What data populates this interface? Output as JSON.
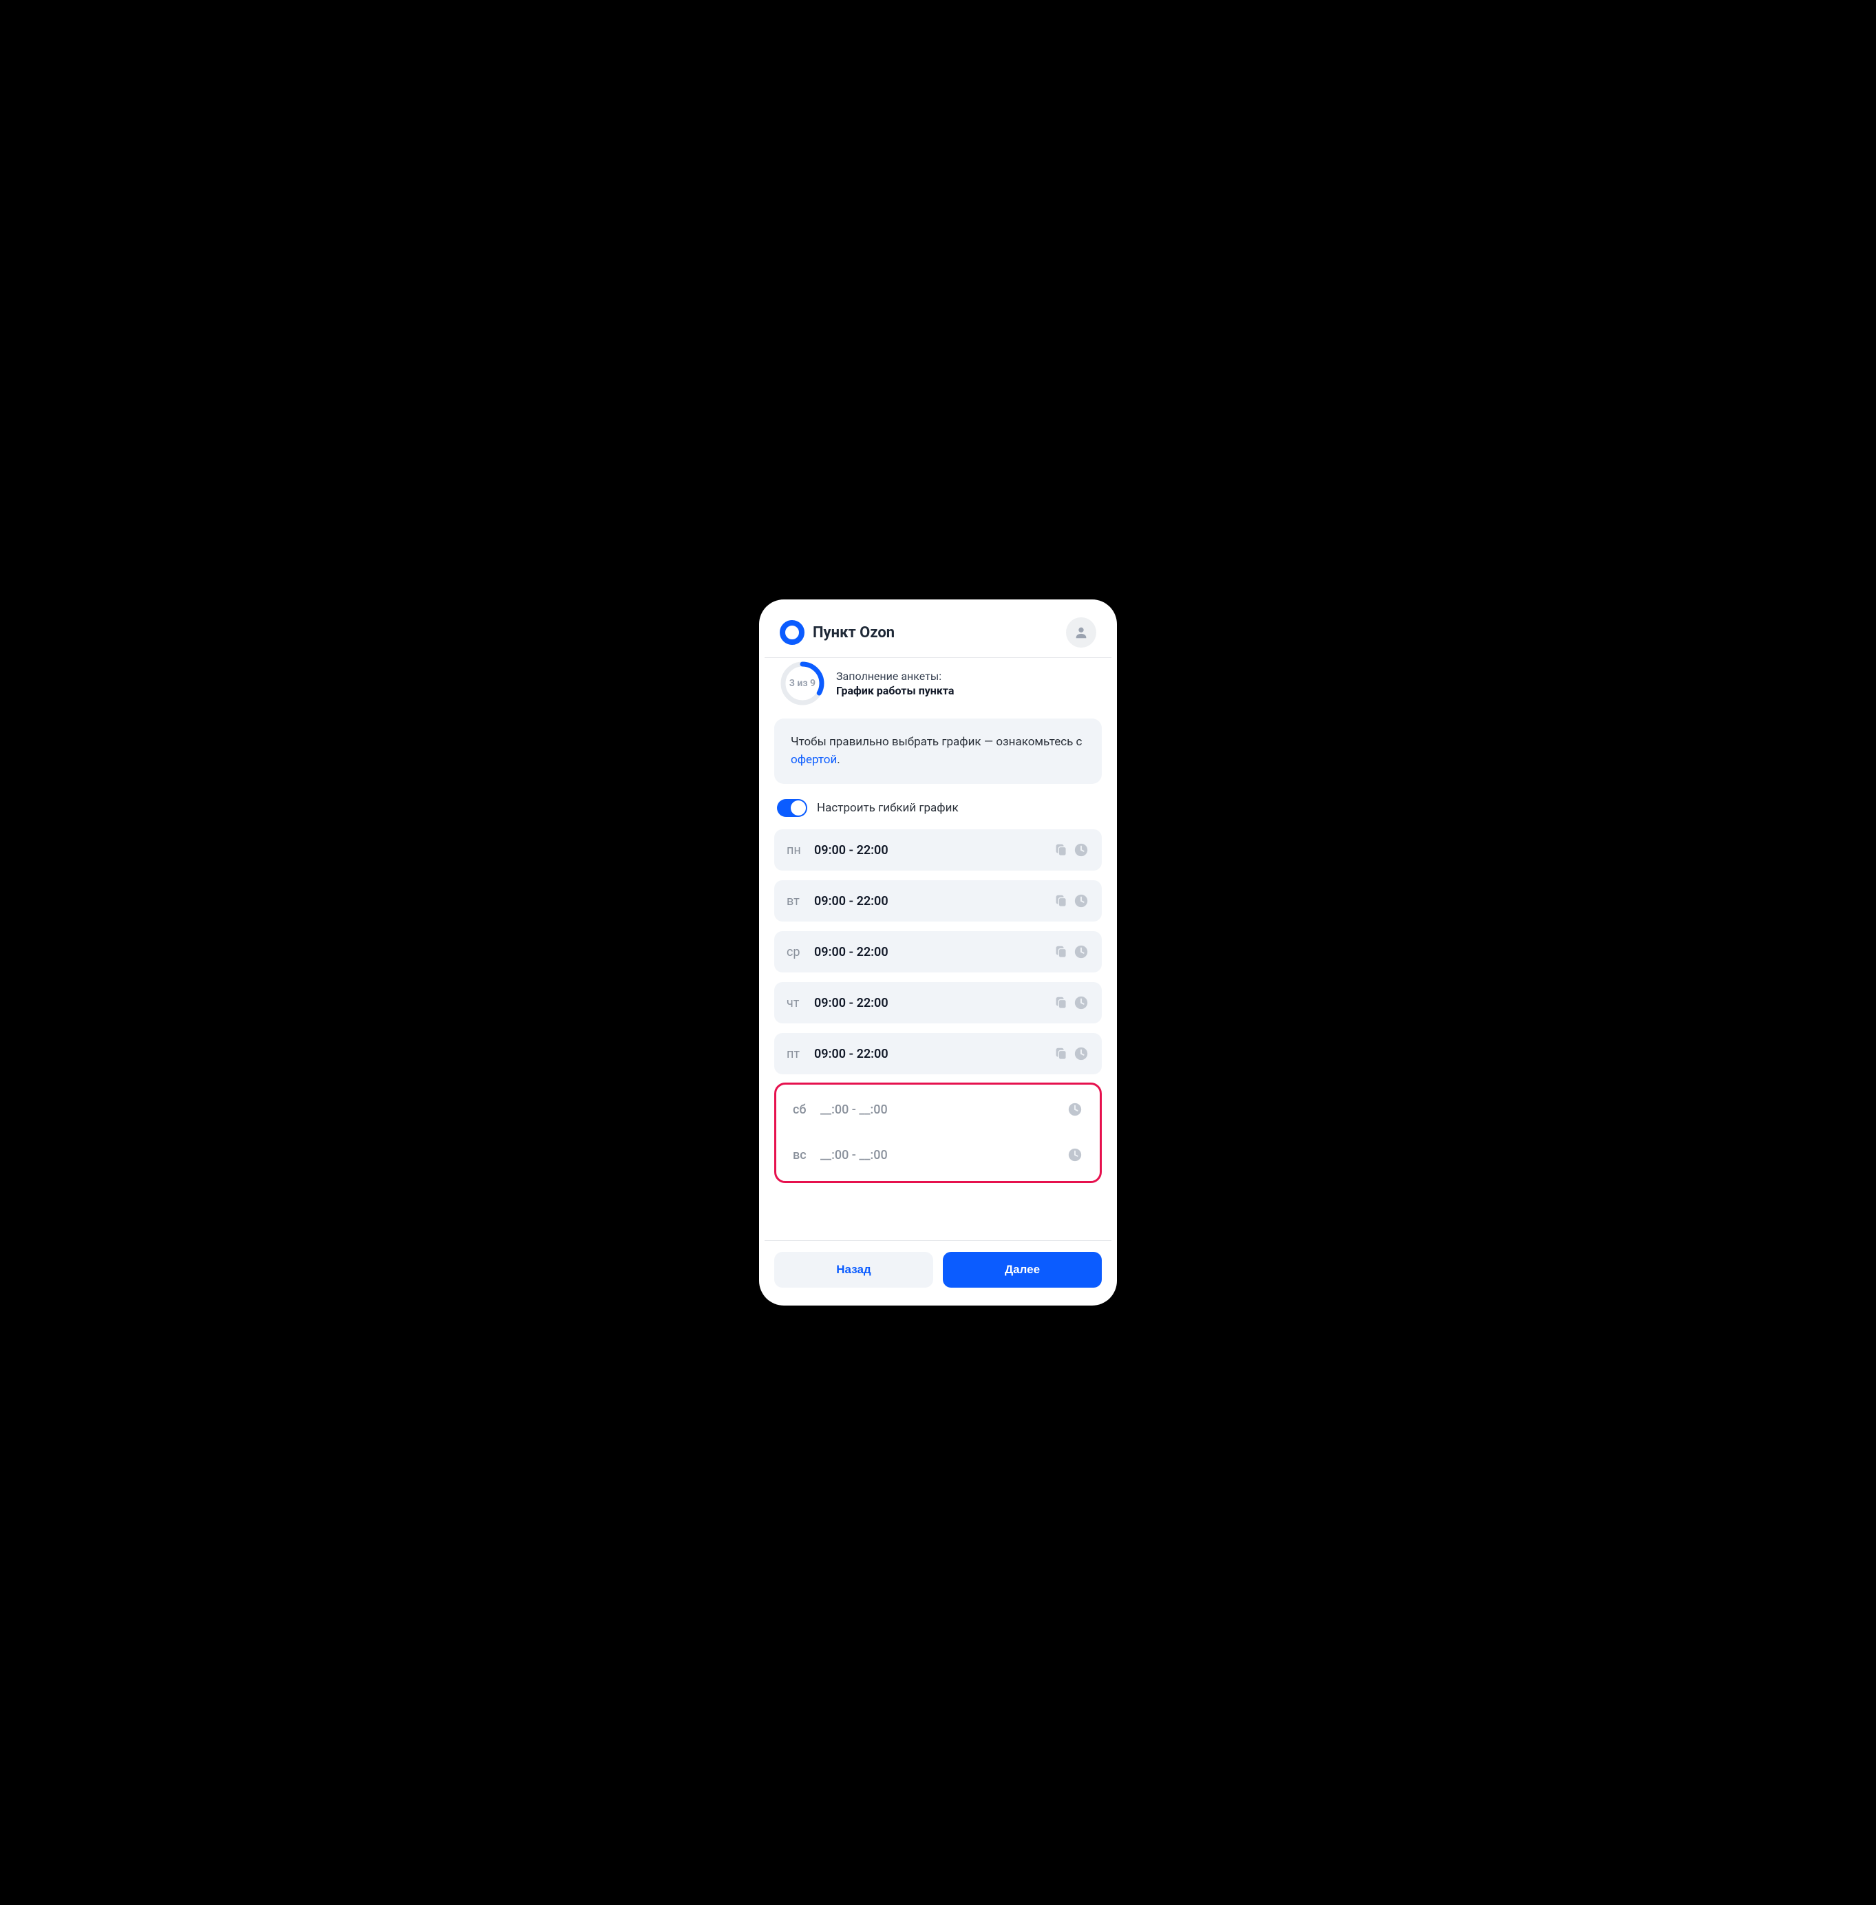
{
  "header": {
    "title": "Пункт Ozon"
  },
  "progress": {
    "step_label": "3 из 9",
    "current": 3,
    "total": 9,
    "title": "Заполнение анкеты:",
    "subtitle": "График работы пункта"
  },
  "info": {
    "text_before": "Чтобы правильно выбрать график — ознакомьтесь с ",
    "link_text": "офертой",
    "text_after": "."
  },
  "toggle": {
    "label": "Настроить гибкий график",
    "on": true
  },
  "schedule": [
    {
      "day": "пн",
      "time": "09:00 - 22:00",
      "has_copy": true
    },
    {
      "day": "вт",
      "time": "09:00 - 22:00",
      "has_copy": true
    },
    {
      "day": "ср",
      "time": "09:00 - 22:00",
      "has_copy": true
    },
    {
      "day": "чт",
      "time": "09:00 - 22:00",
      "has_copy": true
    },
    {
      "day": "пт",
      "time": "09:00 - 22:00",
      "has_copy": true
    }
  ],
  "schedule_empty": [
    {
      "day": "сб",
      "time": "__:00 - __:00"
    },
    {
      "day": "вс",
      "time": "__:00 - __:00"
    }
  ],
  "footer": {
    "back": "Назад",
    "next": "Далее"
  },
  "colors": {
    "accent": "#0b5cff",
    "highlight_border": "#e6114e",
    "muted_bg": "#f1f4f8",
    "text_muted": "#8a919c"
  }
}
